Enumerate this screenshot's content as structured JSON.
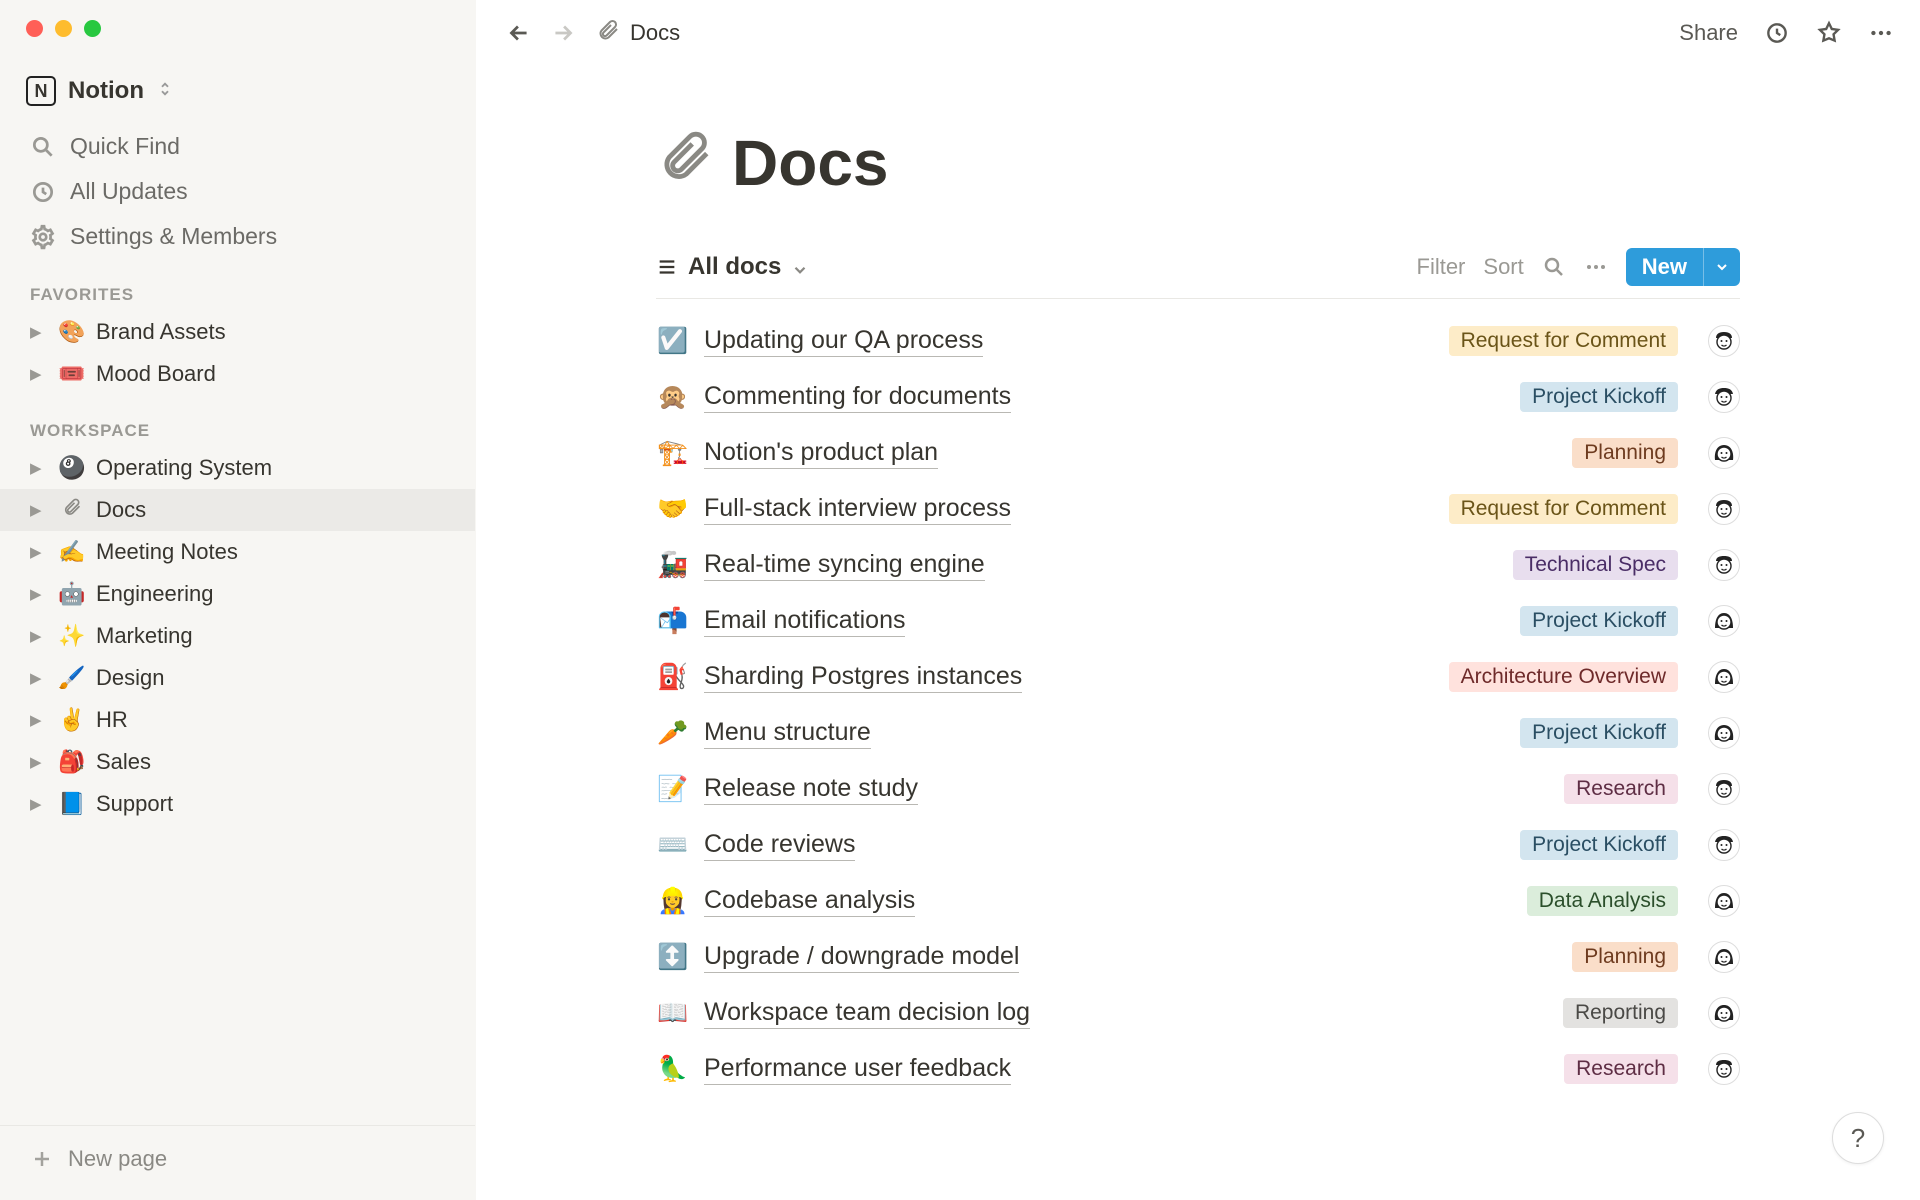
{
  "app_name": "Notion",
  "breadcrumb": {
    "icon": "📎",
    "title": "Docs"
  },
  "topbar": {
    "share": "Share"
  },
  "sidebar": {
    "quick_find": "Quick Find",
    "all_updates": "All Updates",
    "settings": "Settings & Members",
    "favorites_label": "FAVORITES",
    "favorites": [
      {
        "emoji": "🎨",
        "label": "Brand Assets"
      },
      {
        "emoji": "🎟️",
        "label": "Mood Board"
      }
    ],
    "workspace_label": "WORKSPACE",
    "workspace": [
      {
        "emoji": "🎱",
        "label": "Operating System",
        "active": false
      },
      {
        "emoji": "📎",
        "label": "Docs",
        "active": true
      },
      {
        "emoji": "✍️",
        "label": "Meeting Notes",
        "active": false
      },
      {
        "emoji": "🤖",
        "label": "Engineering",
        "active": false
      },
      {
        "emoji": "✨",
        "label": "Marketing",
        "active": false
      },
      {
        "emoji": "🖌️",
        "label": "Design",
        "active": false
      },
      {
        "emoji": "✌️",
        "label": "HR",
        "active": false
      },
      {
        "emoji": "🎒",
        "label": "Sales",
        "active": false
      },
      {
        "emoji": "📘",
        "label": "Support",
        "active": false
      }
    ],
    "new_page": "New page"
  },
  "page": {
    "icon": "📎",
    "title": "Docs"
  },
  "database": {
    "view_name": "All docs",
    "filter": "Filter",
    "sort": "Sort",
    "new": "New",
    "tag_colors": {
      "Request for Comment": "tag-yellow",
      "Project Kickoff": "tag-blue",
      "Planning": "tag-orange",
      "Technical Spec": "tag-purple",
      "Architecture Overview": "tag-red",
      "Research": "tag-pink",
      "Data Analysis": "tag-green",
      "Reporting": "tag-gray"
    },
    "rows": [
      {
        "emoji": "☑️",
        "title": "Updating our QA process",
        "tag": "Request for Comment",
        "avatar": "m1"
      },
      {
        "emoji": "🙊",
        "title": "Commenting for documents",
        "tag": "Project Kickoff",
        "avatar": "m2"
      },
      {
        "emoji": "🏗️",
        "title": "Notion's product plan",
        "tag": "Planning",
        "avatar": "f1"
      },
      {
        "emoji": "🤝",
        "title": "Full-stack interview process",
        "tag": "Request for Comment",
        "avatar": "m1"
      },
      {
        "emoji": "🚂",
        "title": "Real-time syncing engine",
        "tag": "Technical Spec",
        "avatar": "m3"
      },
      {
        "emoji": "📬",
        "title": "Email notifications",
        "tag": "Project Kickoff",
        "avatar": "f2"
      },
      {
        "emoji": "⛽",
        "title": "Sharding Postgres instances",
        "tag": "Architecture Overview",
        "avatar": "f2"
      },
      {
        "emoji": "🥕",
        "title": "Menu structure",
        "tag": "Project Kickoff",
        "avatar": "f1"
      },
      {
        "emoji": "📝",
        "title": "Release note study",
        "tag": "Research",
        "avatar": "m1"
      },
      {
        "emoji": "⌨️",
        "title": "Code reviews",
        "tag": "Project Kickoff",
        "avatar": "m2"
      },
      {
        "emoji": "👷‍♀️",
        "title": "Codebase analysis",
        "tag": "Data Analysis",
        "avatar": "f2"
      },
      {
        "emoji": "↕️",
        "title": "Upgrade / downgrade model",
        "tag": "Planning",
        "avatar": "f2"
      },
      {
        "emoji": "📖",
        "title": "Workspace team decision log",
        "tag": "Reporting",
        "avatar": "f1"
      },
      {
        "emoji": "🦜",
        "title": "Performance user feedback",
        "tag": "Research",
        "avatar": "m3"
      }
    ]
  }
}
